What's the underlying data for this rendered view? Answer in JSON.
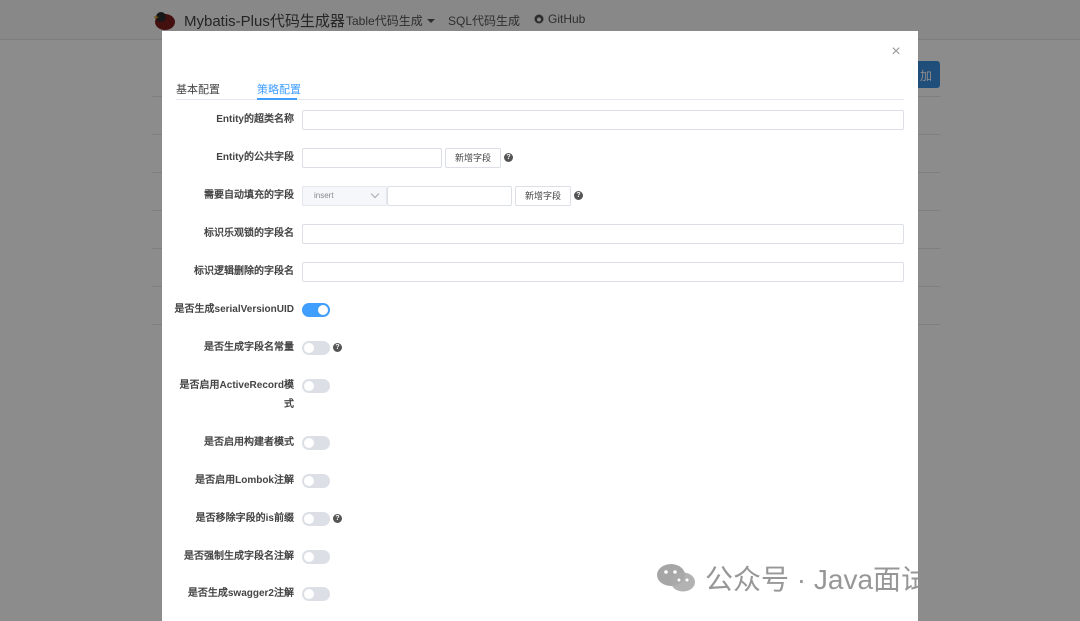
{
  "navbar": {
    "brand": "Mybatis-Plus代码生成器",
    "items": [
      {
        "label": "Table代码生成",
        "dropdown": true
      },
      {
        "label": "SQL代码生成",
        "dropdown": false
      },
      {
        "label": "GitHub",
        "icon": "github-icon"
      }
    ],
    "action_button_partial": "加"
  },
  "modal": {
    "close_symbol": "×",
    "tabs": [
      {
        "label": "基本配置",
        "active": false
      },
      {
        "label": "策略配置",
        "active": true
      }
    ],
    "fields": [
      {
        "label": "Entity的超类名称",
        "type": "text",
        "value": ""
      },
      {
        "label": "Entity的公共字段",
        "type": "text-add",
        "value": "",
        "button": "新增字段",
        "help": true
      },
      {
        "label": "需要自动填充的字段",
        "type": "select-text-add",
        "select_value": "insert",
        "value": "",
        "button": "新增字段",
        "help": true
      },
      {
        "label": "标识乐观锁的字段名",
        "type": "text",
        "value": ""
      },
      {
        "label": "标识逻辑删除的字段名",
        "type": "text",
        "value": ""
      }
    ],
    "switches": [
      {
        "label": "是否生成serialVersionUID",
        "on": true,
        "help": false
      },
      {
        "label": "是否生成字段名常量",
        "on": false,
        "help": true
      },
      {
        "label_line1": "是否启用ActiveRecord模",
        "label_line2": "式",
        "on": false,
        "help": false
      },
      {
        "label": "是否启用构建者模式",
        "on": false,
        "help": false
      },
      {
        "label": "是否启用Lombok注解",
        "on": false,
        "help": false
      },
      {
        "label": "是否移除字段的is前缀",
        "on": false,
        "help": true
      },
      {
        "label": "是否强制生成字段名注解",
        "on": false,
        "help": false
      },
      {
        "label": "是否生成swagger2注解",
        "on": false,
        "help": false
      }
    ],
    "help_symbol": "?"
  },
  "watermark": {
    "text": "公众号 · Java面试题精选"
  },
  "colors": {
    "accent": "#409eff",
    "overlay": "rgba(0,0,0,0.45)"
  }
}
